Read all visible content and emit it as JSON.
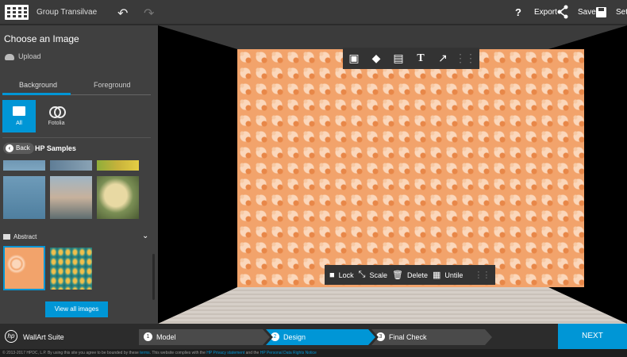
{
  "header": {
    "group_name": "Group Transilvae",
    "help_label": "?",
    "export_label": "Export",
    "save_label": "Save",
    "settings_label": "Set"
  },
  "sidebar": {
    "title": "Choose an Image",
    "upload_label": "Upload",
    "tabs": [
      {
        "label": "Background"
      },
      {
        "label": "Foreground"
      }
    ],
    "sources": [
      {
        "label": "All"
      },
      {
        "label": "Fotolia"
      }
    ],
    "back_label": "Back",
    "category_title": "HP Samples",
    "folder_label": "Abstract",
    "view_all_label": "View all images"
  },
  "wall_toolbar_bottom": {
    "lock": "Lock",
    "scale": "Scale",
    "delete": "Delete",
    "untile": "Untile"
  },
  "footer": {
    "suite_name": "WallArt Suite",
    "steps": [
      {
        "num": "1",
        "label": "Model"
      },
      {
        "num": "2",
        "label": "Design"
      },
      {
        "num": "3",
        "label": "Final Check"
      }
    ],
    "next_label": "NEXT",
    "legal_text": "© 2013-2017 HPDC, L.P.  By using this site you agree to be bounded by these",
    "terms_link": "terms",
    "legal_text2": ". This website complies with the",
    "privacy_link": "HP Privacy statement",
    "legal_text3": "and the",
    "rights_link": "HP Personal Data Rights Notice"
  },
  "colors": {
    "accent": "#0096d6",
    "wall": "#f2a36b"
  }
}
